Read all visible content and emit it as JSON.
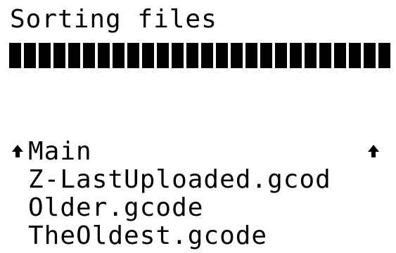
{
  "screen": {
    "title": "Sorting files",
    "progress_percent": 100
  },
  "menu": {
    "items": [
      {
        "label": "Main",
        "icon": "up-arrow-icon",
        "has_right_icon": true
      },
      {
        "label": "Z-LastUploaded.gcod"
      },
      {
        "label": "Older.gcode"
      },
      {
        "label": "TheOldest.gcode"
      }
    ]
  },
  "colors": {
    "background": "#ffffff",
    "foreground": "#000000"
  }
}
